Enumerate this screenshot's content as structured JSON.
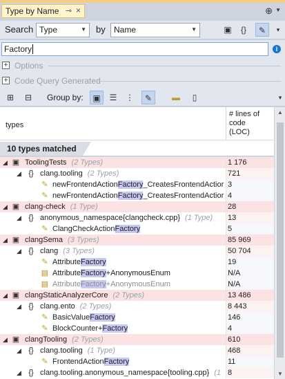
{
  "tab": {
    "title": "Type by Name",
    "pin": "⊸",
    "close": "×"
  },
  "toolbar": {
    "search_label": "Search",
    "search_kind": "Type",
    "by_label": "by",
    "by_value": "Name"
  },
  "search": {
    "value": "Factory"
  },
  "options_label": "Options",
  "code_query_label": "Code Query Generated",
  "group_by_label": "Group by:",
  "columns": {
    "types": "types",
    "loc": "# lines of code (LOC)"
  },
  "matched_label": "10 types matched",
  "rows": [
    {
      "level": 0,
      "expander": "◢",
      "icon": "▣",
      "name": "ToolingTests",
      "count": "(2 Types)",
      "value": "1 176"
    },
    {
      "level": 1,
      "expander": "◢",
      "icon": "{}",
      "name": "clang.tooling",
      "count": "(2 Types)",
      "value": "721"
    },
    {
      "level": 2,
      "icon": "✎",
      "pre": "newFrontendAction",
      "hl": "Factory",
      "post": "_CreatesFrontendActior",
      "value": "3"
    },
    {
      "level": 2,
      "icon": "✎",
      "pre": "newFrontendAction",
      "hl": "Factory",
      "post": "_CreatesFrontendActior",
      "value": "4"
    },
    {
      "level": 0,
      "expander": "◢",
      "icon": "▣",
      "name": "clang-check",
      "count": "(1 Type)",
      "value": "28"
    },
    {
      "level": 1,
      "expander": "◢",
      "icon": "{}",
      "name": "anonymous_namespace{clangcheck.cpp}",
      "count": "(1 Type)",
      "value": "13"
    },
    {
      "level": 2,
      "icon": "✎",
      "pre": "ClangCheckAction",
      "hl": "Factory",
      "post": "",
      "value": "5"
    },
    {
      "level": 0,
      "expander": "◢",
      "icon": "▣",
      "name": "clangSema",
      "count": "(3 Types)",
      "value": "85 969"
    },
    {
      "level": 1,
      "expander": "◢",
      "icon": "{}",
      "name": "clang",
      "count": "(3 Types)",
      "value": "50 704"
    },
    {
      "level": 2,
      "icon": "✎",
      "pre": "Attribute",
      "hl": "Factory",
      "post": "",
      "value": "19"
    },
    {
      "level": 2,
      "icon": "▤",
      "pre": "Attribute",
      "hl": "Factory",
      "post": "+AnonymousEnum",
      "value": "N/A"
    },
    {
      "level": 2,
      "icon": "▤",
      "pre": "Attribute",
      "hl": "Factory",
      "post": "+AnonymousEnum",
      "value": "N/A",
      "grey": true
    },
    {
      "level": 0,
      "expander": "◢",
      "icon": "▣",
      "name": "clangStaticAnalyzerCore",
      "count": "(2 Types)",
      "value": "13 486"
    },
    {
      "level": 1,
      "expander": "◢",
      "icon": "{}",
      "name": "clang.ento",
      "count": "(2 Types)",
      "value": "8 443"
    },
    {
      "level": 2,
      "icon": "✎",
      "pre": "BasicValue",
      "hl": "Factory",
      "post": "",
      "value": "146"
    },
    {
      "level": 2,
      "icon": "✎",
      "pre": "BlockCounter+",
      "hl": "Factory",
      "post": "",
      "value": "4"
    },
    {
      "level": 0,
      "expander": "◢",
      "icon": "▣",
      "name": "clangTooling",
      "count": "(2 Types)",
      "value": "610"
    },
    {
      "level": 1,
      "expander": "◢",
      "icon": "{}",
      "name": "clang.tooling",
      "count": "(1 Type)",
      "value": "468"
    },
    {
      "level": 2,
      "icon": "✎",
      "pre": "FrontendAction",
      "hl": "Factory",
      "post": "",
      "value": "11"
    },
    {
      "level": 1,
      "expander": "◢",
      "icon": "{}",
      "name": "clang.tooling.anonymous_namespace{tooling.cpp}",
      "count": "(1",
      "value": "8"
    }
  ]
}
